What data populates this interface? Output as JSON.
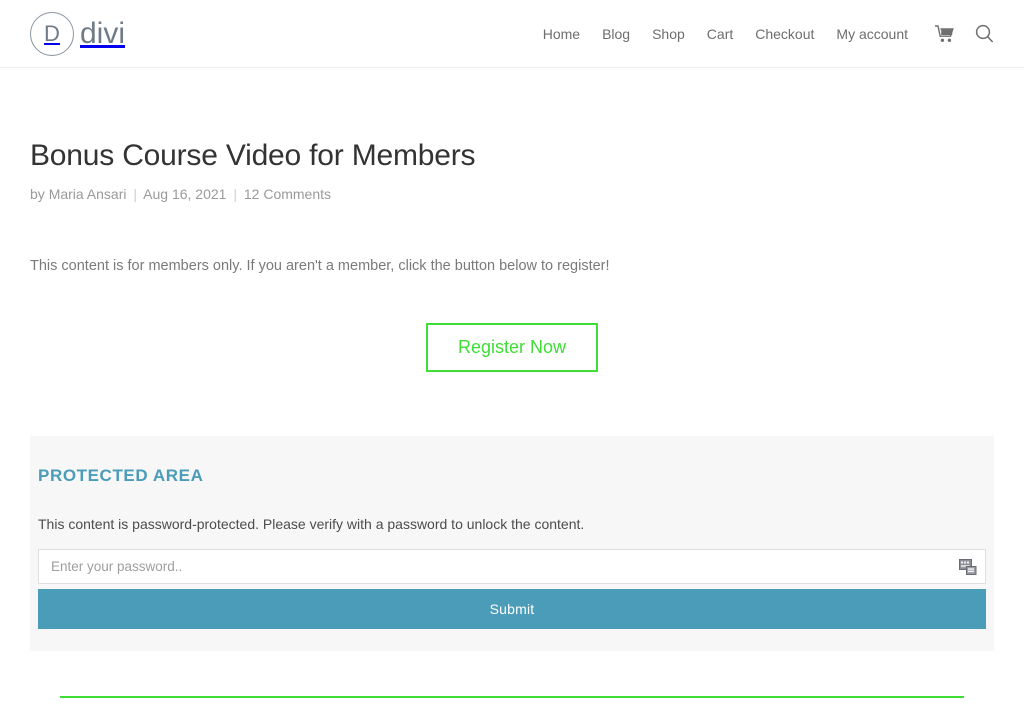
{
  "header": {
    "logo": {
      "mark_letter": "D",
      "text": "divi"
    },
    "nav": [
      {
        "label": "Home"
      },
      {
        "label": "Blog"
      },
      {
        "label": "Shop"
      },
      {
        "label": "Cart"
      },
      {
        "label": "Checkout"
      },
      {
        "label": "My account"
      }
    ],
    "icons": [
      {
        "name": "cart-icon"
      },
      {
        "name": "search-icon"
      }
    ]
  },
  "post": {
    "title": "Bonus Course Video for Members",
    "meta": {
      "by_label": "by",
      "author": "Maria Ansari",
      "separator": "|",
      "date": "Aug 16, 2021",
      "comments": "12 Comments"
    },
    "intro": "This content is for members only. If you aren't a member, click the button below to register!",
    "register_button": "Register Now"
  },
  "protected": {
    "heading": "PROTECTED AREA",
    "description": "This content is password-protected. Please verify with a password to unlock the content.",
    "password_placeholder": "Enter your password..",
    "password_value": "",
    "password_icon": "clipboard-paste-icon",
    "submit_label": "Submit"
  },
  "colors": {
    "accent_green": "#3fdd36",
    "accent_teal": "#4a9cb8",
    "panel_background": "#f7f7f7",
    "text_muted": "#9a9a9a"
  }
}
